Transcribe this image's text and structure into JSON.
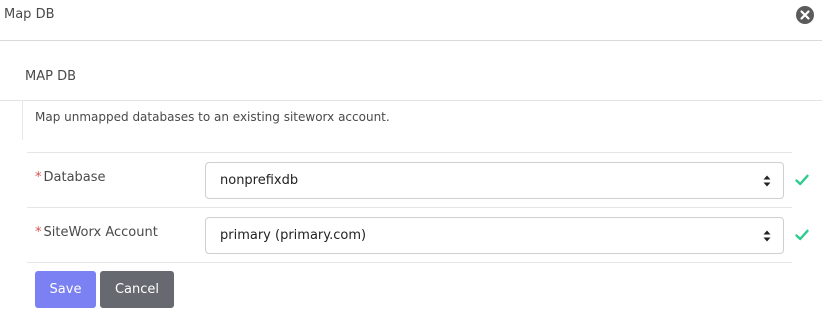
{
  "header": {
    "title": "Map DB",
    "close_icon": "close-circle-icon"
  },
  "section": {
    "title": "MAP DB",
    "description": "Map unmapped databases to an existing siteworx account."
  },
  "form": {
    "required_marker": "*",
    "fields": [
      {
        "label": "Database",
        "value": "nonprefixdb",
        "valid": true
      },
      {
        "label": "SiteWorx Account",
        "value": "primary (primary.com)",
        "valid": true
      }
    ]
  },
  "buttons": {
    "save": "Save",
    "cancel": "Cancel"
  },
  "colors": {
    "primary_button": "#7b80f2",
    "secondary_button": "#666a70",
    "valid_check": "#2ecc8f",
    "required_asterisk": "#d9534f"
  }
}
